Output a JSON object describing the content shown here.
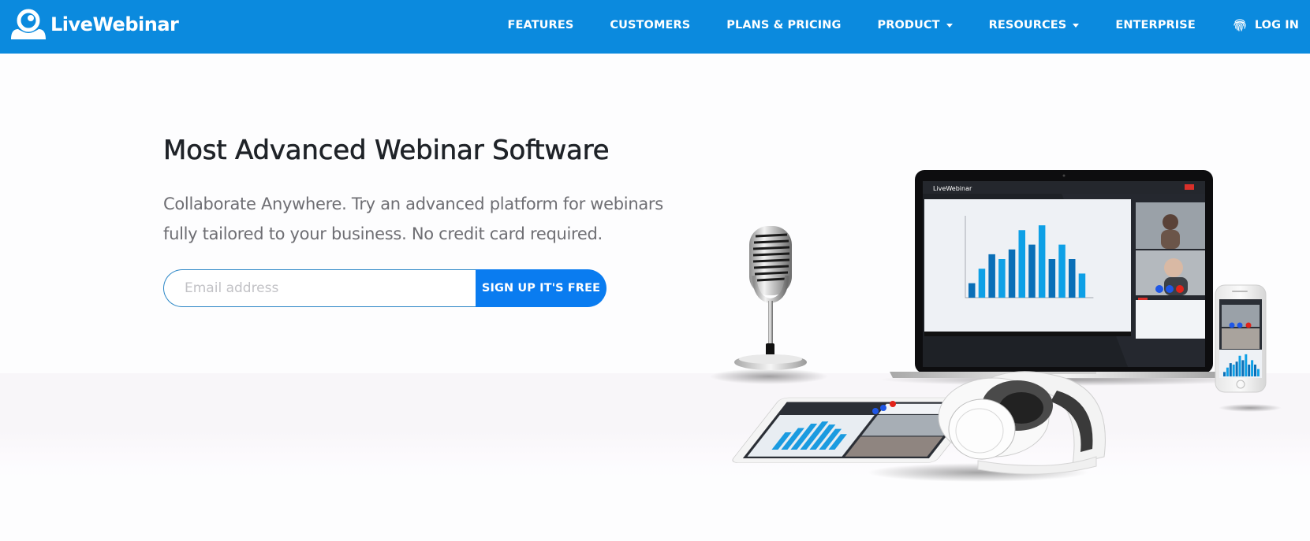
{
  "brand": {
    "name": "LiveWebinar",
    "logo_icon": "webcam-logo-icon",
    "primary_color": "#0b8ade",
    "button_color": "#0a7cf0"
  },
  "nav": {
    "items": [
      {
        "label": "FEATURES",
        "has_dropdown": false
      },
      {
        "label": "CUSTOMERS",
        "has_dropdown": false
      },
      {
        "label": "PLANS & PRICING",
        "has_dropdown": false
      },
      {
        "label": "PRODUCT",
        "has_dropdown": true
      },
      {
        "label": "RESOURCES",
        "has_dropdown": true
      },
      {
        "label": "ENTERPRISE",
        "has_dropdown": false
      }
    ],
    "login": {
      "label": "LOG IN",
      "icon": "fingerprint-icon"
    }
  },
  "hero": {
    "title": "Most Advanced Webinar Software",
    "subtitle_line1": "Collaborate Anywhere. Try an advanced platform for webinars",
    "subtitle_line2": "fully tailored to your business. No credit card required.",
    "email_placeholder": "Email address",
    "email_value": "",
    "cta_label": "SIGN UP IT'S FREE"
  },
  "illustration": {
    "description": "Laptop, tablet, phone, microphone and headphones showing the webinar app",
    "app_name": "LiveWebinar",
    "screen_chart_values": [
      3,
      6,
      9,
      8,
      10,
      14,
      11,
      15,
      8,
      11,
      8,
      5
    ],
    "screen_chart_max": 16,
    "call_buttons": [
      "camera",
      "microphone",
      "hang-up"
    ]
  }
}
